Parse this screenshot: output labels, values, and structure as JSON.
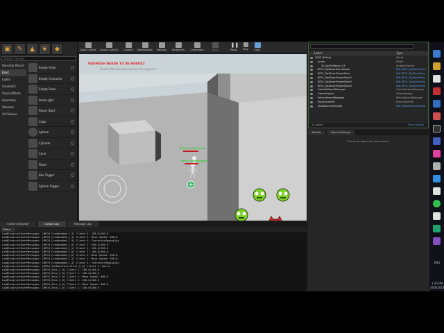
{
  "modes": {
    "search_placeholder": "Search Classes",
    "categories": [
      "Recently Placed",
      "Basic",
      "Lights",
      "Cinematic",
      "Visual Effects",
      "Geometry",
      "Volumes",
      "All Classes"
    ],
    "items": [
      "Empty Actor",
      "Empty Character",
      "Empty Pawn",
      "Point Light",
      "Player Start",
      "Cube",
      "Sphere",
      "Cylinder",
      "Cone",
      "Plane",
      "Box Trigger",
      "Sphere Trigger"
    ]
  },
  "toolbar": {
    "buttons": [
      "Save Current",
      "Source Control",
      "Content",
      "Marketplace",
      "Settings",
      "Blueprints",
      "Cinematics",
      "Build",
      "Pause",
      "Stop",
      "Eject"
    ]
  },
  "viewport": {
    "warning": "NAVMESH NEEDS TO BE REBUILT",
    "hint": "Shader/Mesh/Landscape/etc to suppress",
    "tags": [
      "BPCH_CrowHeaded",
      "BPCH_CrowHeaded"
    ]
  },
  "outliner": {
    "columns": [
      "Label",
      "Type"
    ],
    "rows": [
      {
        "name": "LRGP (Editor)",
        "type": "World",
        "link": false
      },
      {
        "name": "Audio",
        "type": "Folder",
        "link": false
      },
      {
        "name": "3d_AptTheBase_C/E",
        "type": "AmbientSound",
        "link": false
      },
      {
        "name": "BP01_TopDownGameMode",
        "type": "Edit BP01_TopDownGam",
        "link": true
      },
      {
        "name": "BP01_TopDownPlayerState",
        "type": "Edit BP01_TopDownPlay",
        "link": true
      },
      {
        "name": "BP01_TopDownPlayerState2",
        "type": "Edit BP01_TopDownPlay",
        "link": true
      },
      {
        "name": "BP01_TopDownPlayerState3",
        "type": "Edit BP01_TopDownPlay",
        "link": true
      },
      {
        "name": "BP01_TopDownPlayerState4",
        "type": "Edit BP01_TopDownPlay",
        "link": true
      },
      {
        "name": "GameNetworkManager",
        "type": "GameNetworkManager",
        "link": false
      },
      {
        "name": "GameSession",
        "type": "GameSession",
        "link": false
      },
      {
        "name": "ParticleEventManager",
        "type": "ParticleEventManager",
        "link": false
      },
      {
        "name": "PlayerStartPIE",
        "type": "PlayerStartPIE",
        "link": false
      },
      {
        "name": "StateMachineHolder",
        "type": "Edit StateMachineHolde",
        "link": true
      }
    ],
    "count": "13 actors",
    "view_options": "View Options"
  },
  "details": {
    "tabs": [
      "Details",
      "World Settings"
    ],
    "message": "Select an object to view details."
  },
  "log": {
    "tabs": [
      "Content Browser",
      "Output Log",
      "Message Log"
    ],
    "filter": "Filters",
    "lines": [
      "LogBlueprintUserMessages: [BPCH_CrowHeaded_C_3] Client 5: 100.0/100.0",
      "LogBlueprintUserMessages: [BPCH_CrowHeaded_C_3] Client 5: Move Speed: 600.0",
      "LogBlueprintUserMessages: [BPCH_CrowHeaded_C_3] Client 5: CharacterBegonplay",
      "LogBlueprintUserMessages: [BPCH_CrowHeaded_C_0] Client 2: 100.0/100.0",
      "LogBlueprintUserMessages: [BPCH_CrowHeaded_C_1] Client 2: 100.0/100.0",
      "LogBlueprintUserMessages: [BPCH_CrowHeaded_C_0] Client 2: 100.0/100.0",
      "LogBlueprintUserMessages: [BPCH_CrowHeaded_C_0] Client 2: Move Speed: 650.0",
      "LogBlueprintUserMessages: [BPCH_CrowHeaded_C_3] Client 2: Move Speed: 650.0",
      "LogBlueprintUserMessages: [BPCH_CrowHeaded_C_3] Client 3: CharacterBegonplay",
      "LogBlueprintUserMessages: [BP04_TopDownController_C_0] Client 1: Hello",
      "LogBlueprintUserMessages: [BPCH_Zeus_C_0] Client 1: 100.0/100.0",
      "LogBlueprintUserMessages: [BPCH_Zeus_C_0] Client 1: 100.0/100.0",
      "LogBlueprintUserMessages: [BPCH_Zeus_C_0] Client 1: Move Speed: 600.0",
      "LogBlueprintUserMessages: [BPCH_Zeus_C_0] Client 1: 100.0/100.0",
      "LogBlueprintUserMessages: [BPCH_Zeus_C_0] Client 1: Move Speed: 600.0",
      "LogBlueprintUserMessages: [BPCH_Zeus_C_0] Client 1: 100.0/100.0"
    ]
  },
  "taskbar": {
    "lang": "ENG",
    "time": "1:45 PM",
    "date": "26/8/2018"
  },
  "colors": {
    "warning": "#e03030",
    "tag": "#2ed030",
    "link": "#5aa0e8"
  }
}
